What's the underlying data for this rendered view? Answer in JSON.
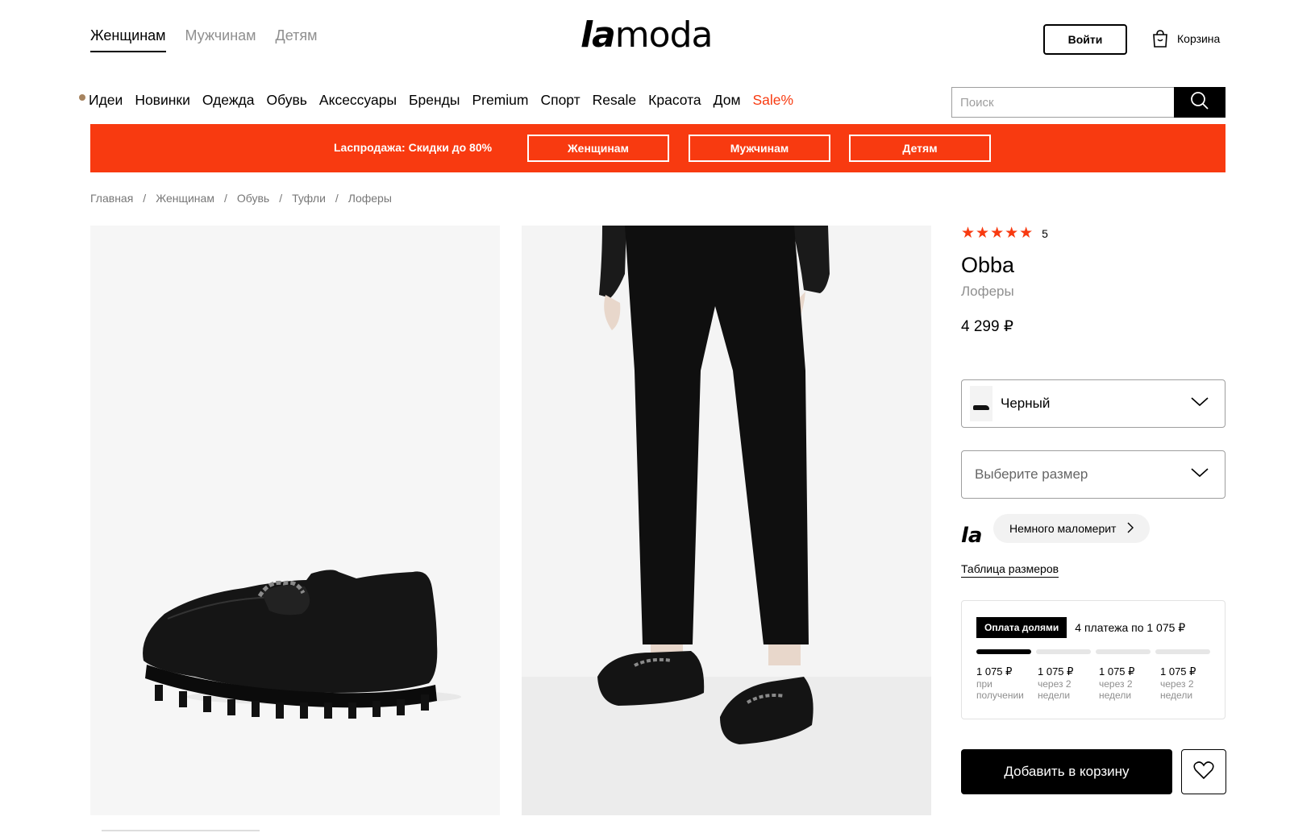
{
  "header": {
    "gender_tabs": [
      "Женщинам",
      "Мужчинам",
      "Детям"
    ],
    "logo_la": "la",
    "logo_moda": "moda",
    "login_label": "Войти",
    "cart_label": "Корзина"
  },
  "categories": [
    "Идеи",
    "Новинки",
    "Одежда",
    "Обувь",
    "Аксессуары",
    "Бренды",
    "Premium",
    "Спорт",
    "Resale",
    "Красота",
    "Дом"
  ],
  "sale_label": "Sale%",
  "search": {
    "placeholder": "Поиск"
  },
  "banner": {
    "text": "Lаспродажа: Скидки до 80%",
    "buttons": [
      "Женщинам",
      "Мужчинам",
      "Детям"
    ],
    "color": "#f83a10"
  },
  "breadcrumb": [
    "Главная",
    "Женщинам",
    "Обувь",
    "Туфли",
    "Лоферы"
  ],
  "product": {
    "stars": "★★★★★",
    "rating": "5",
    "brand": "Obba",
    "category": "Лоферы",
    "price": "4 299 ₽",
    "color": "Черный",
    "size_placeholder": "Выберите размер",
    "fit_logo": "la",
    "fit_note": "Немного маломерит",
    "size_table": "Таблица размеров",
    "add_to_cart": "Добавить в корзину"
  },
  "installment": {
    "badge": "Оплата долями",
    "summary": "4 платежа по 1 075 ₽",
    "paid_parts": 1,
    "payments": [
      {
        "amount": "1 075 ₽",
        "when": "при получении"
      },
      {
        "amount": "1 075 ₽",
        "when": "через 2 недели"
      },
      {
        "amount": "1 075 ₽",
        "when": "через 2 недели"
      },
      {
        "amount": "1 075 ₽",
        "when": "через 2 недели"
      }
    ]
  },
  "icons": [
    "cart-icon",
    "search-icon",
    "chevron-down-icon",
    "chevron-right-icon",
    "heart-icon"
  ]
}
